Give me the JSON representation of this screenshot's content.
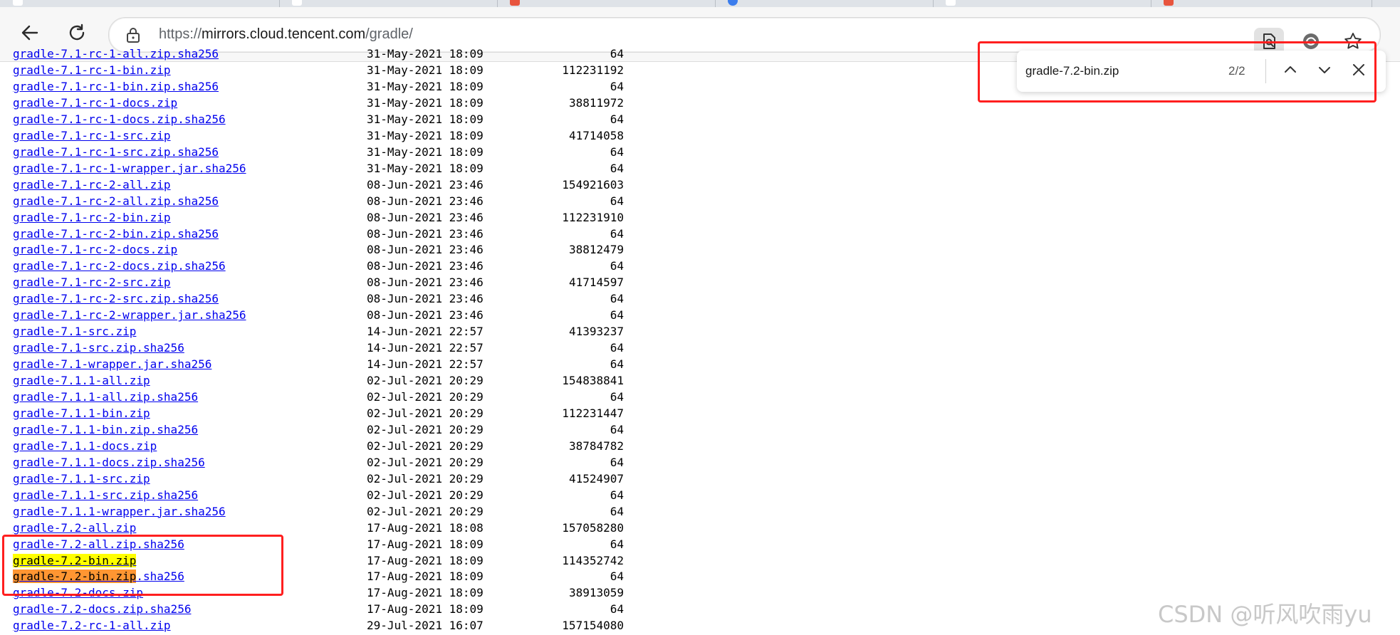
{
  "tabs": [
    {
      "favicon_color": "#ffffff"
    },
    {
      "favicon_color": "#ffffff"
    },
    {
      "favicon_color": "#e8553e"
    },
    {
      "favicon_color": "#3b7ded"
    },
    {
      "favicon_color": "#ffffff"
    },
    {
      "favicon_color": "#e8553e"
    }
  ],
  "toolbar": {
    "back_icon": "arrow-left-icon",
    "reload_icon": "reload-icon",
    "lock_icon": "lock-icon",
    "url_prefix": "https://",
    "url_host": "mirrors.cloud.tencent.com",
    "url_path": "/gradle/",
    "right_icons": [
      "find-in-page-icon",
      "edge-refresh-icon",
      "favorite-star-icon"
    ]
  },
  "listing": {
    "rows": [
      {
        "name": "gradle-7.1-rc-1-bin.zip",
        "date": "31-May-2021 18:09",
        "size": "112231192"
      },
      {
        "name": "gradle-7.1-rc-1-bin.zip.sha256",
        "date": "31-May-2021 18:09",
        "size": "64"
      },
      {
        "name": "gradle-7.1-rc-1-docs.zip",
        "date": "31-May-2021 18:09",
        "size": "38811972"
      },
      {
        "name": "gradle-7.1-rc-1-docs.zip.sha256",
        "date": "31-May-2021 18:09",
        "size": "64"
      },
      {
        "name": "gradle-7.1-rc-1-src.zip",
        "date": "31-May-2021 18:09",
        "size": "41714058"
      },
      {
        "name": "gradle-7.1-rc-1-src.zip.sha256",
        "date": "31-May-2021 18:09",
        "size": "64"
      },
      {
        "name": "gradle-7.1-rc-1-wrapper.jar.sha256",
        "date": "31-May-2021 18:09",
        "size": "64"
      },
      {
        "name": "gradle-7.1-rc-2-all.zip",
        "date": "08-Jun-2021 23:46",
        "size": "154921603"
      },
      {
        "name": "gradle-7.1-rc-2-all.zip.sha256",
        "date": "08-Jun-2021 23:46",
        "size": "64"
      },
      {
        "name": "gradle-7.1-rc-2-bin.zip",
        "date": "08-Jun-2021 23:46",
        "size": "112231910"
      },
      {
        "name": "gradle-7.1-rc-2-bin.zip.sha256",
        "date": "08-Jun-2021 23:46",
        "size": "64"
      },
      {
        "name": "gradle-7.1-rc-2-docs.zip",
        "date": "08-Jun-2021 23:46",
        "size": "38812479"
      },
      {
        "name": "gradle-7.1-rc-2-docs.zip.sha256",
        "date": "08-Jun-2021 23:46",
        "size": "64"
      },
      {
        "name": "gradle-7.1-rc-2-src.zip",
        "date": "08-Jun-2021 23:46",
        "size": "41714597"
      },
      {
        "name": "gradle-7.1-rc-2-src.zip.sha256",
        "date": "08-Jun-2021 23:46",
        "size": "64"
      },
      {
        "name": "gradle-7.1-rc-2-wrapper.jar.sha256",
        "date": "08-Jun-2021 23:46",
        "size": "64"
      },
      {
        "name": "gradle-7.1-src.zip",
        "date": "14-Jun-2021 22:57",
        "size": "41393237"
      },
      {
        "name": "gradle-7.1-src.zip.sha256",
        "date": "14-Jun-2021 22:57",
        "size": "64"
      },
      {
        "name": "gradle-7.1-wrapper.jar.sha256",
        "date": "14-Jun-2021 22:57",
        "size": "64"
      },
      {
        "name": "gradle-7.1.1-all.zip",
        "date": "02-Jul-2021 20:29",
        "size": "154838841"
      },
      {
        "name": "gradle-7.1.1-all.zip.sha256",
        "date": "02-Jul-2021 20:29",
        "size": "64"
      },
      {
        "name": "gradle-7.1.1-bin.zip",
        "date": "02-Jul-2021 20:29",
        "size": "112231447"
      },
      {
        "name": "gradle-7.1.1-bin.zip.sha256",
        "date": "02-Jul-2021 20:29",
        "size": "64"
      },
      {
        "name": "gradle-7.1.1-docs.zip",
        "date": "02-Jul-2021 20:29",
        "size": "38784782"
      },
      {
        "name": "gradle-7.1.1-docs.zip.sha256",
        "date": "02-Jul-2021 20:29",
        "size": "64"
      },
      {
        "name": "gradle-7.1.1-src.zip",
        "date": "02-Jul-2021 20:29",
        "size": "41524907"
      },
      {
        "name": "gradle-7.1.1-src.zip.sha256",
        "date": "02-Jul-2021 20:29",
        "size": "64"
      },
      {
        "name": "gradle-7.1.1-wrapper.jar.sha256",
        "date": "02-Jul-2021 20:29",
        "size": "64"
      },
      {
        "name": "gradle-7.2-all.zip",
        "date": "17-Aug-2021 18:08",
        "size": "157058280"
      },
      {
        "name": "gradle-7.2-all.zip.sha256",
        "date": "17-Aug-2021 18:09",
        "size": "64"
      },
      {
        "name": "gradle-7.2-bin.zip",
        "date": "17-Aug-2021 18:09",
        "size": "114352742",
        "highlight": "yellow"
      },
      {
        "name": "gradle-7.2-bin.zip",
        "name_suffix": ".sha256",
        "date": "17-Aug-2021 18:09",
        "size": "64",
        "highlight": "orange"
      },
      {
        "name": "gradle-7.2-docs.zip",
        "date": "17-Aug-2021 18:09",
        "size": "38913059"
      },
      {
        "name": "gradle-7.2-docs.zip.sha256",
        "date": "17-Aug-2021 18:09",
        "size": "64"
      },
      {
        "name": "gradle-7.2-rc-1-all.zip",
        "date": "29-Jul-2021 16:07",
        "size": "157154080"
      }
    ]
  },
  "findbar": {
    "query": "gradle-7.2-bin.zip",
    "count": "2/2",
    "prev_icon": "chevron-up-icon",
    "next_icon": "chevron-down-icon",
    "close_icon": "close-icon"
  },
  "colors": {
    "link": "#0000ee",
    "highlight_current": "#ff9632",
    "highlight_match": "#ffff00",
    "annotation": "#ff1f1f"
  },
  "watermark": "CSDN @听风吹雨yu"
}
